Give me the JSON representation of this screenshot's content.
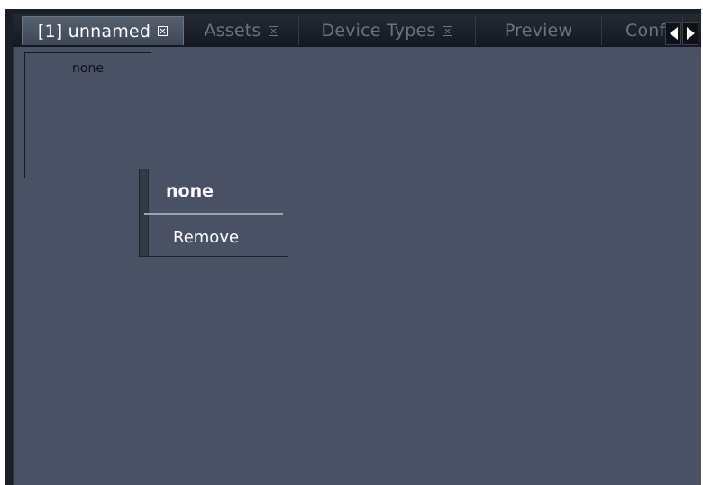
{
  "tabs": [
    {
      "label": "[1] unnamed",
      "active": true,
      "closable": true
    },
    {
      "label": "Assets",
      "active": false,
      "closable": true
    },
    {
      "label": "Device Types",
      "active": false,
      "closable": true
    },
    {
      "label": "Preview",
      "active": false,
      "closable": false
    },
    {
      "label": "Conf",
      "active": false,
      "closable": false
    }
  ],
  "cell": {
    "label": "none"
  },
  "context_menu": {
    "header": "none",
    "items": [
      {
        "label": "Remove"
      }
    ]
  },
  "colors": {
    "content_bg": "#485264",
    "active_tab_bg": "#55606f",
    "inactive_tab_text": "#6a7381"
  }
}
